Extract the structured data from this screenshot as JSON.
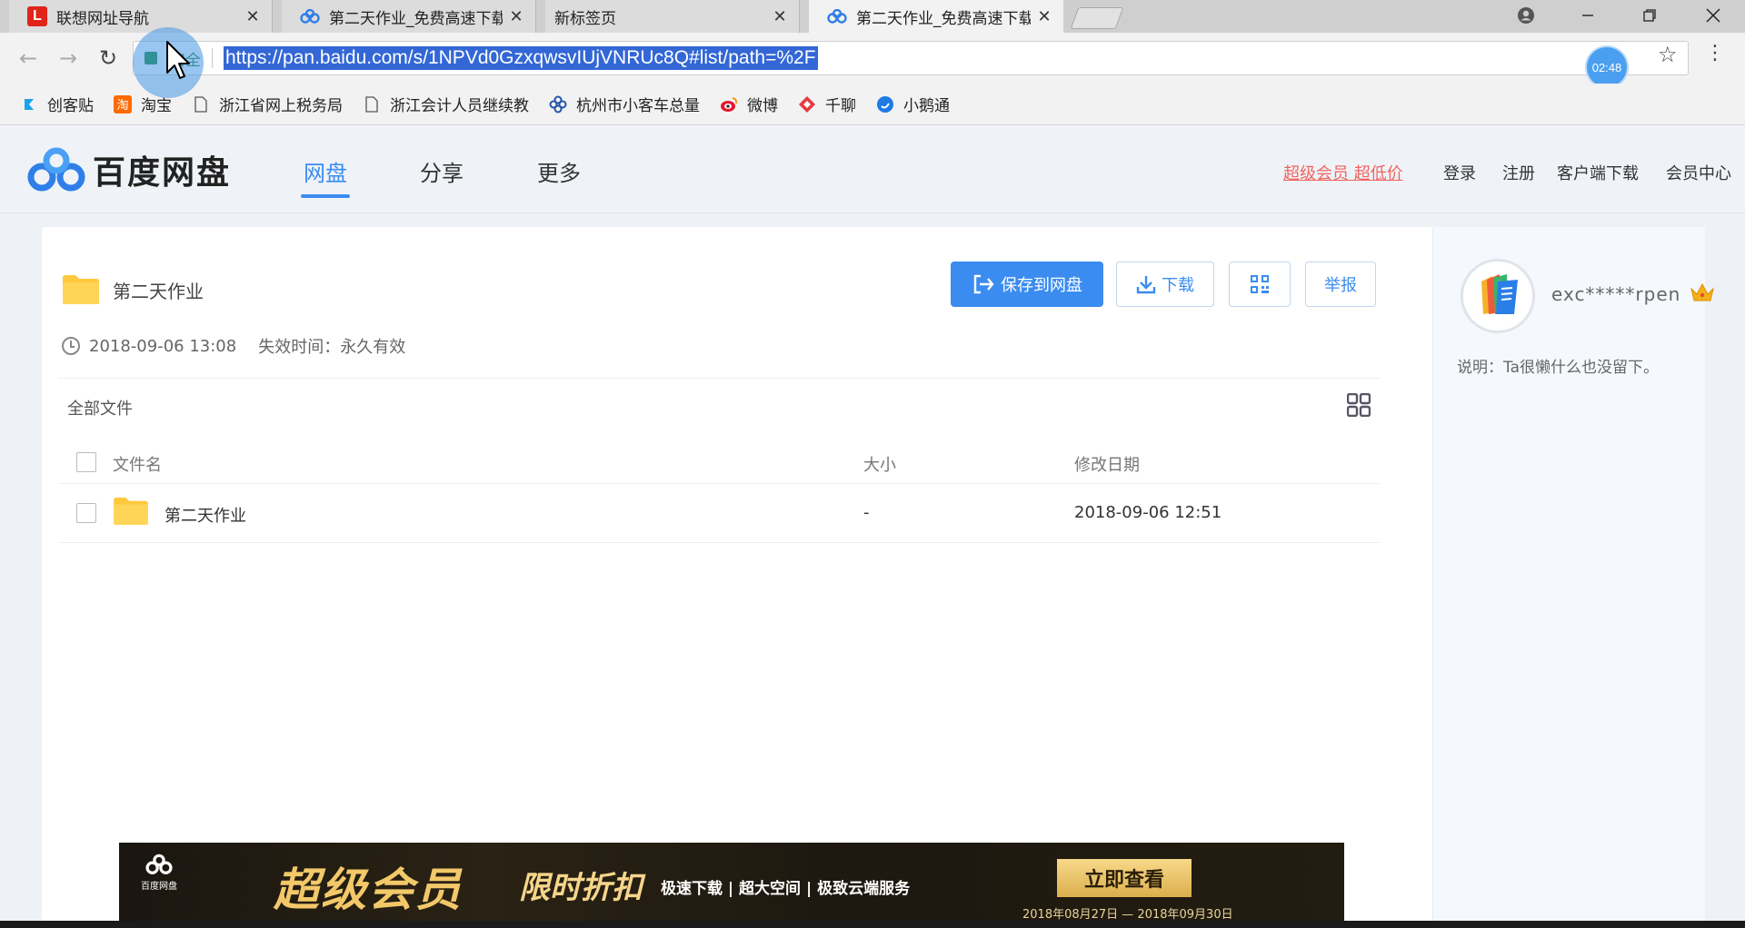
{
  "browser": {
    "tabs": [
      {
        "title": "联想网址导航",
        "favicon": "L"
      },
      {
        "title": "第二天作业_免费高速下载"
      },
      {
        "title": "新标签页"
      },
      {
        "title": "第二天作业_免费高速下载"
      }
    ],
    "security_label": "安全",
    "url": "https://pan.baidu.com/s/1NPVd0GzxqwsvIUjVNRUc8Q#list/path=%2F",
    "timer": "02:48",
    "bookmarks": [
      "创客贴",
      "淘宝",
      "浙江省网上税务局",
      "浙江会计人员继续教",
      "杭州市小客车总量",
      "微博",
      "千聊",
      "小鹅通"
    ]
  },
  "header": {
    "logo_text": "百度网盘",
    "nav": [
      "网盘",
      "分享",
      "更多"
    ],
    "promo": "超级会员 超低价",
    "links": [
      "登录",
      "注册",
      "客户端下载",
      "会员中心"
    ]
  },
  "share": {
    "title": "第二天作业",
    "buttons": {
      "save": "保存到网盘",
      "download": "下载",
      "report": "举报"
    },
    "created": "2018-09-06 13:08",
    "expiry_label": "失效时间：永久有效",
    "all_files": "全部文件",
    "columns": [
      "文件名",
      "大小",
      "修改日期"
    ],
    "files": [
      {
        "name": "第二天作业",
        "size": "-",
        "modified": "2018-09-06 12:51"
      }
    ]
  },
  "user": {
    "name": "exc*****rpen",
    "desc": "说明：Ta很懒什么也没留下。"
  },
  "banner": {
    "logo": "百度网盘",
    "vip": "超级会员",
    "sale": "限时折扣",
    "features": "极速下载 | 超大空间 | 极致云端服务",
    "cta": "立即查看",
    "dates": "2018年08月27日 — 2018年09月30日"
  },
  "colors": {
    "accent": "#3b8cf0",
    "promo": "#f0645e",
    "url_highlight": "#3367d6"
  }
}
